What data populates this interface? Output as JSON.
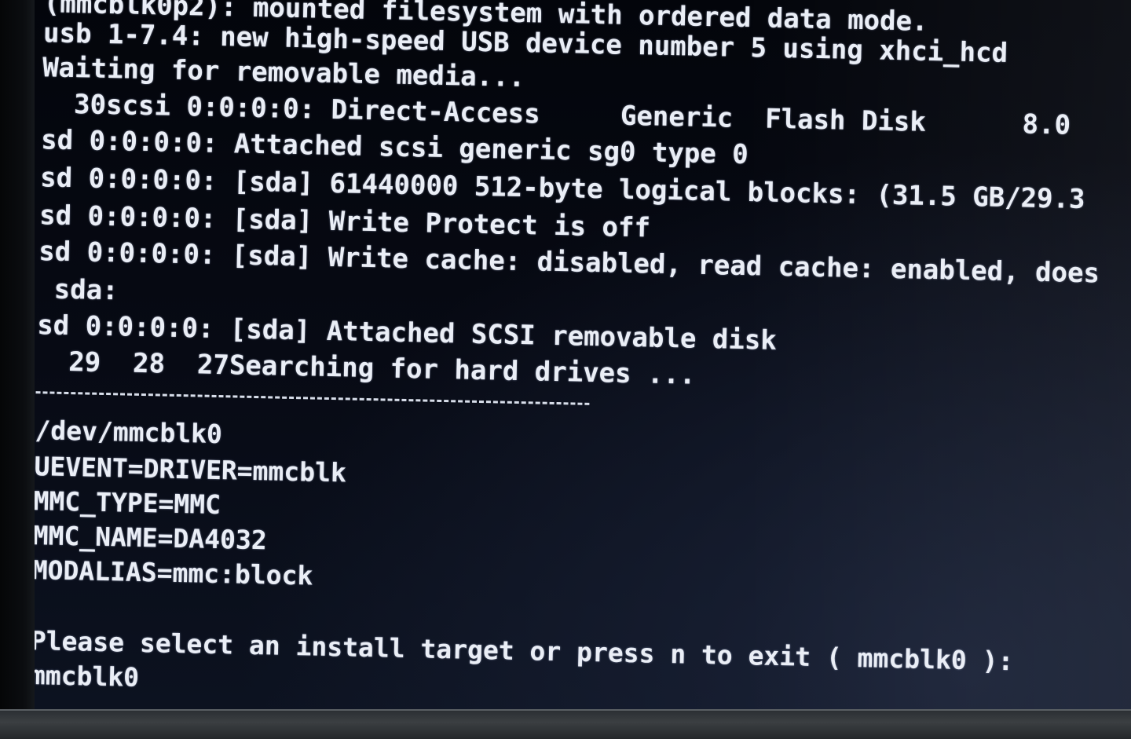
{
  "terminal": {
    "lines": [
      "(mmcblk0p2): mounted filesystem with ordered data mode.",
      "usb 1-7.4: new high-speed USB device number 5 using xhci_hcd",
      "Waiting for removable media...",
      "  30scsi 0:0:0:0: Direct-Access     Generic  Flash Disk      8.0",
      "sd 0:0:0:0: Attached scsi generic sg0 type 0",
      "sd 0:0:0:0: [sda] 61440000 512-byte logical blocks: (31.5 GB/29.3",
      "sd 0:0:0:0: [sda] Write Protect is off",
      "sd 0:0:0:0: [sda] Write cache: disabled, read cache: enabled, does",
      " sda:",
      "sd 0:0:0:0: [sda] Attached SCSI removable disk",
      "  29  28  27Searching for hard drives ..."
    ],
    "lower_lines": [
      "/dev/mmcblk0",
      "UEVENT=DRIVER=mmcblk",
      "MMC_TYPE=MMC",
      "MMC_NAME=DA4032",
      "MODALIAS=mmc:block",
      "",
      "Please select an install target or press n to exit ( mmcblk0 ):",
      "mmcblk0"
    ]
  },
  "colors": {
    "text": "#eaeef6",
    "background": "#070a14",
    "bezel": "#2b2f33"
  }
}
